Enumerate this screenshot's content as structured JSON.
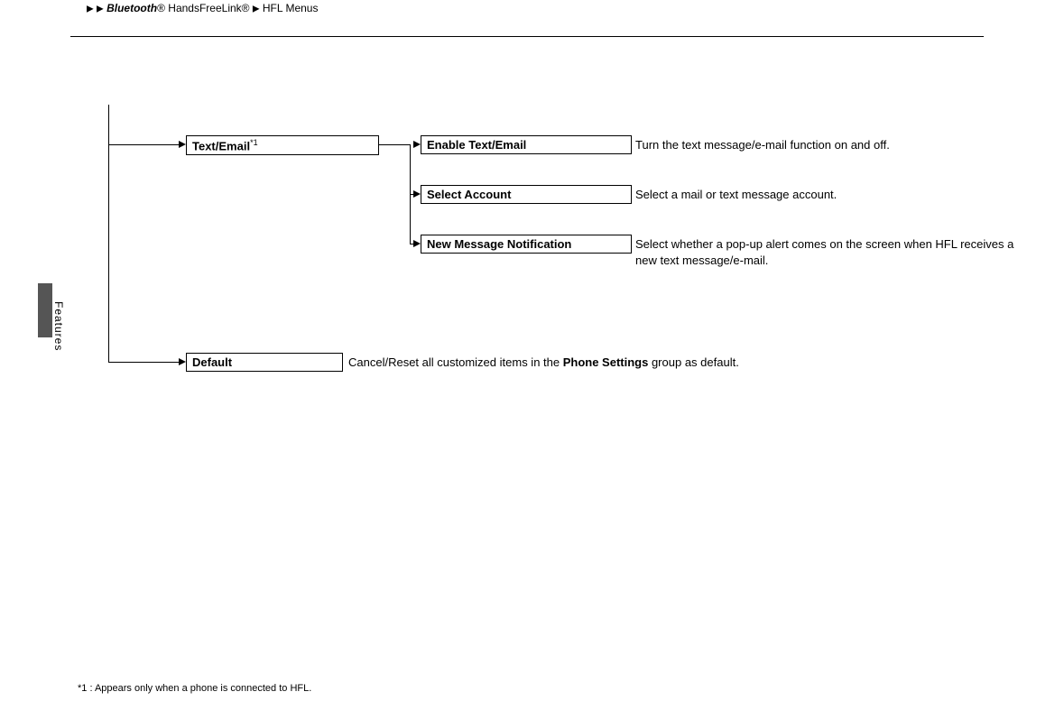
{
  "breadcrumb": {
    "part1": "Bluetooth",
    "reg1": "®",
    "part2": "HandsFreeLink",
    "reg2": "®",
    "part3": "HFL Menus"
  },
  "sidebar": {
    "label": "Features"
  },
  "nodes": {
    "textEmail": {
      "label": "Text/Email",
      "sup": "*1"
    },
    "enable": {
      "label": "Enable Text/Email",
      "desc": "Turn the text message/e-mail function on and off."
    },
    "selectAccount": {
      "label": "Select Account",
      "desc": "Select a mail or text message account."
    },
    "newMsg": {
      "label": "New Message Notification",
      "desc": "Select whether a pop-up alert comes on the screen when HFL receives a new text message/e-mail."
    },
    "default": {
      "label": "Default",
      "desc_pre": "Cancel/Reset all customized items in the ",
      "desc_bold": "Phone Settings",
      "desc_post": " group as default."
    }
  },
  "footnote": {
    "text": "*1 : Appears only when a phone is connected to HFL."
  }
}
